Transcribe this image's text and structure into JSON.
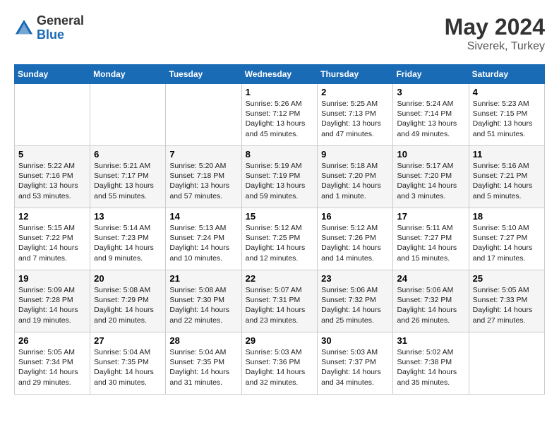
{
  "header": {
    "logo_general": "General",
    "logo_blue": "Blue",
    "title": "May 2024",
    "location": "Siverek, Turkey"
  },
  "days_of_week": [
    "Sunday",
    "Monday",
    "Tuesday",
    "Wednesday",
    "Thursday",
    "Friday",
    "Saturday"
  ],
  "weeks": [
    [
      {
        "day": "",
        "sunrise": "",
        "sunset": "",
        "daylight": ""
      },
      {
        "day": "",
        "sunrise": "",
        "sunset": "",
        "daylight": ""
      },
      {
        "day": "",
        "sunrise": "",
        "sunset": "",
        "daylight": ""
      },
      {
        "day": "1",
        "sunrise": "Sunrise: 5:26 AM",
        "sunset": "Sunset: 7:12 PM",
        "daylight": "Daylight: 13 hours and 45 minutes."
      },
      {
        "day": "2",
        "sunrise": "Sunrise: 5:25 AM",
        "sunset": "Sunset: 7:13 PM",
        "daylight": "Daylight: 13 hours and 47 minutes."
      },
      {
        "day": "3",
        "sunrise": "Sunrise: 5:24 AM",
        "sunset": "Sunset: 7:14 PM",
        "daylight": "Daylight: 13 hours and 49 minutes."
      },
      {
        "day": "4",
        "sunrise": "Sunrise: 5:23 AM",
        "sunset": "Sunset: 7:15 PM",
        "daylight": "Daylight: 13 hours and 51 minutes."
      }
    ],
    [
      {
        "day": "5",
        "sunrise": "Sunrise: 5:22 AM",
        "sunset": "Sunset: 7:16 PM",
        "daylight": "Daylight: 13 hours and 53 minutes."
      },
      {
        "day": "6",
        "sunrise": "Sunrise: 5:21 AM",
        "sunset": "Sunset: 7:17 PM",
        "daylight": "Daylight: 13 hours and 55 minutes."
      },
      {
        "day": "7",
        "sunrise": "Sunrise: 5:20 AM",
        "sunset": "Sunset: 7:18 PM",
        "daylight": "Daylight: 13 hours and 57 minutes."
      },
      {
        "day": "8",
        "sunrise": "Sunrise: 5:19 AM",
        "sunset": "Sunset: 7:19 PM",
        "daylight": "Daylight: 13 hours and 59 minutes."
      },
      {
        "day": "9",
        "sunrise": "Sunrise: 5:18 AM",
        "sunset": "Sunset: 7:20 PM",
        "daylight": "Daylight: 14 hours and 1 minute."
      },
      {
        "day": "10",
        "sunrise": "Sunrise: 5:17 AM",
        "sunset": "Sunset: 7:20 PM",
        "daylight": "Daylight: 14 hours and 3 minutes."
      },
      {
        "day": "11",
        "sunrise": "Sunrise: 5:16 AM",
        "sunset": "Sunset: 7:21 PM",
        "daylight": "Daylight: 14 hours and 5 minutes."
      }
    ],
    [
      {
        "day": "12",
        "sunrise": "Sunrise: 5:15 AM",
        "sunset": "Sunset: 7:22 PM",
        "daylight": "Daylight: 14 hours and 7 minutes."
      },
      {
        "day": "13",
        "sunrise": "Sunrise: 5:14 AM",
        "sunset": "Sunset: 7:23 PM",
        "daylight": "Daylight: 14 hours and 9 minutes."
      },
      {
        "day": "14",
        "sunrise": "Sunrise: 5:13 AM",
        "sunset": "Sunset: 7:24 PM",
        "daylight": "Daylight: 14 hours and 10 minutes."
      },
      {
        "day": "15",
        "sunrise": "Sunrise: 5:12 AM",
        "sunset": "Sunset: 7:25 PM",
        "daylight": "Daylight: 14 hours and 12 minutes."
      },
      {
        "day": "16",
        "sunrise": "Sunrise: 5:12 AM",
        "sunset": "Sunset: 7:26 PM",
        "daylight": "Daylight: 14 hours and 14 minutes."
      },
      {
        "day": "17",
        "sunrise": "Sunrise: 5:11 AM",
        "sunset": "Sunset: 7:27 PM",
        "daylight": "Daylight: 14 hours and 15 minutes."
      },
      {
        "day": "18",
        "sunrise": "Sunrise: 5:10 AM",
        "sunset": "Sunset: 7:27 PM",
        "daylight": "Daylight: 14 hours and 17 minutes."
      }
    ],
    [
      {
        "day": "19",
        "sunrise": "Sunrise: 5:09 AM",
        "sunset": "Sunset: 7:28 PM",
        "daylight": "Daylight: 14 hours and 19 minutes."
      },
      {
        "day": "20",
        "sunrise": "Sunrise: 5:08 AM",
        "sunset": "Sunset: 7:29 PM",
        "daylight": "Daylight: 14 hours and 20 minutes."
      },
      {
        "day": "21",
        "sunrise": "Sunrise: 5:08 AM",
        "sunset": "Sunset: 7:30 PM",
        "daylight": "Daylight: 14 hours and 22 minutes."
      },
      {
        "day": "22",
        "sunrise": "Sunrise: 5:07 AM",
        "sunset": "Sunset: 7:31 PM",
        "daylight": "Daylight: 14 hours and 23 minutes."
      },
      {
        "day": "23",
        "sunrise": "Sunrise: 5:06 AM",
        "sunset": "Sunset: 7:32 PM",
        "daylight": "Daylight: 14 hours and 25 minutes."
      },
      {
        "day": "24",
        "sunrise": "Sunrise: 5:06 AM",
        "sunset": "Sunset: 7:32 PM",
        "daylight": "Daylight: 14 hours and 26 minutes."
      },
      {
        "day": "25",
        "sunrise": "Sunrise: 5:05 AM",
        "sunset": "Sunset: 7:33 PM",
        "daylight": "Daylight: 14 hours and 27 minutes."
      }
    ],
    [
      {
        "day": "26",
        "sunrise": "Sunrise: 5:05 AM",
        "sunset": "Sunset: 7:34 PM",
        "daylight": "Daylight: 14 hours and 29 minutes."
      },
      {
        "day": "27",
        "sunrise": "Sunrise: 5:04 AM",
        "sunset": "Sunset: 7:35 PM",
        "daylight": "Daylight: 14 hours and 30 minutes."
      },
      {
        "day": "28",
        "sunrise": "Sunrise: 5:04 AM",
        "sunset": "Sunset: 7:35 PM",
        "daylight": "Daylight: 14 hours and 31 minutes."
      },
      {
        "day": "29",
        "sunrise": "Sunrise: 5:03 AM",
        "sunset": "Sunset: 7:36 PM",
        "daylight": "Daylight: 14 hours and 32 minutes."
      },
      {
        "day": "30",
        "sunrise": "Sunrise: 5:03 AM",
        "sunset": "Sunset: 7:37 PM",
        "daylight": "Daylight: 14 hours and 34 minutes."
      },
      {
        "day": "31",
        "sunrise": "Sunrise: 5:02 AM",
        "sunset": "Sunset: 7:38 PM",
        "daylight": "Daylight: 14 hours and 35 minutes."
      },
      {
        "day": "",
        "sunrise": "",
        "sunset": "",
        "daylight": ""
      }
    ]
  ]
}
